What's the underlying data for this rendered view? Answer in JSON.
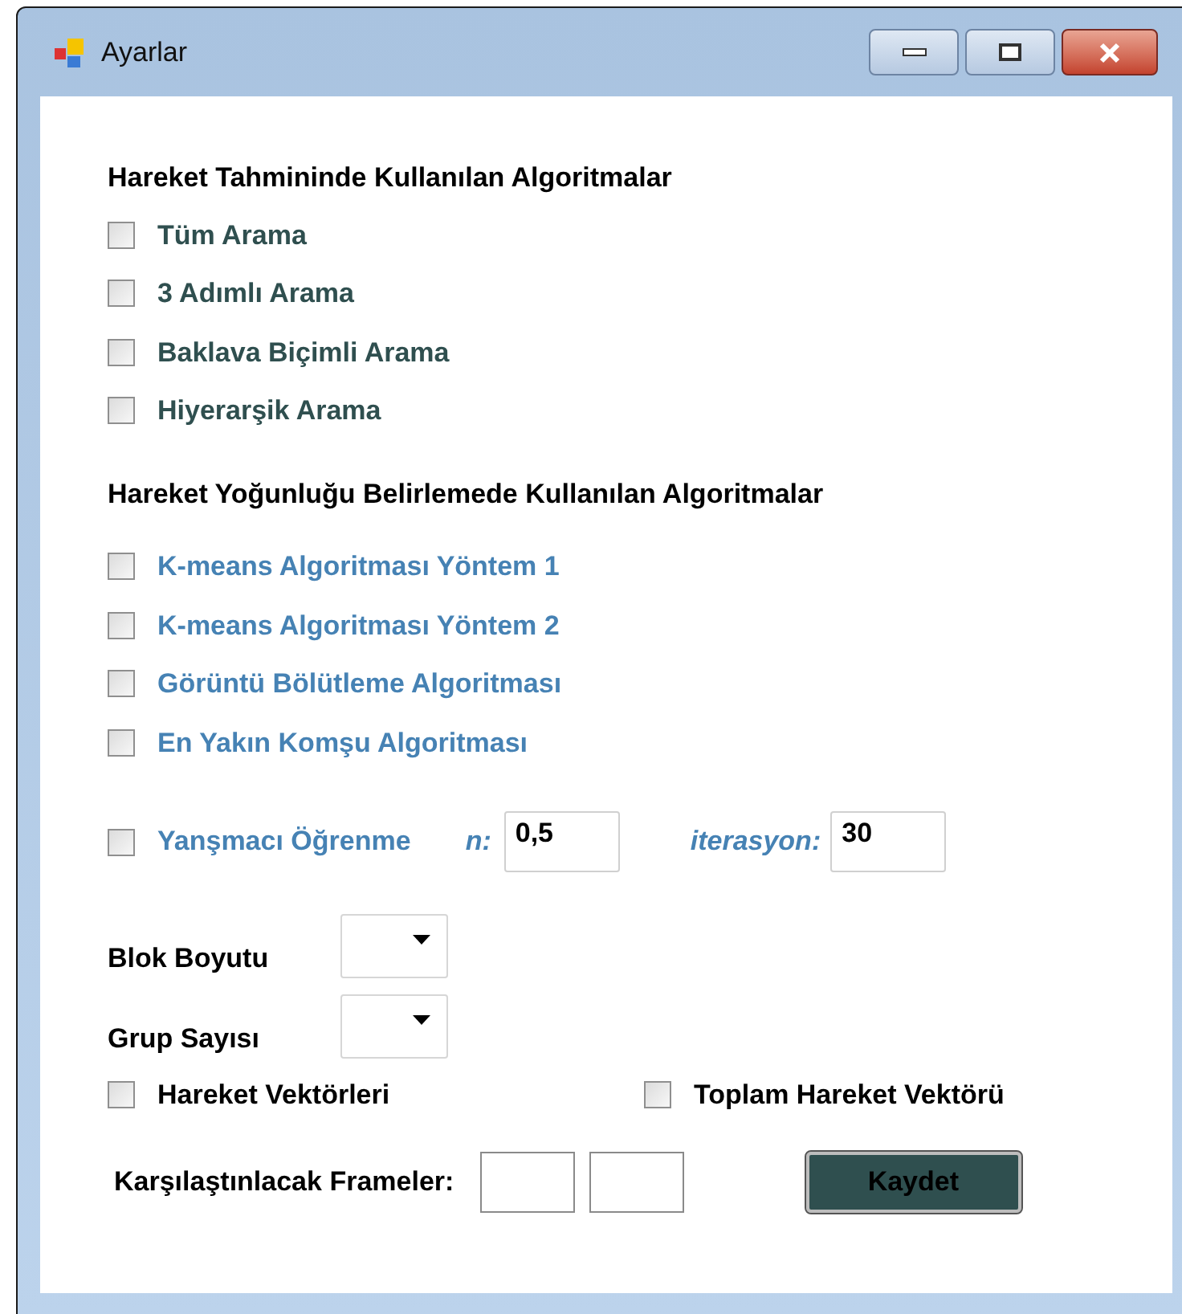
{
  "window": {
    "title": "Ayarlar"
  },
  "sections": [
    {
      "heading": "Hareket Tahmininde Kullanılan Algoritmalar",
      "items": [
        {
          "label": "Tüm Arama",
          "checked": false
        },
        {
          "label": "3 Adımlı Arama",
          "checked": false
        },
        {
          "label": "Baklava Biçimli Arama",
          "checked": false
        },
        {
          "label": "Hiyerarşik Arama",
          "checked": false
        }
      ]
    },
    {
      "heading": "Hareket Yoğunluğu Belirlemede Kullanılan Algoritmalar",
      "items": [
        {
          "label": "K-means Algoritması Yöntem 1",
          "checked": false
        },
        {
          "label": "K-means Algoritması Yöntem 2",
          "checked": false
        },
        {
          "label": "Görüntü Bölütleme Algoritması",
          "checked": false
        },
        {
          "label": "En Yakın Komşu Algoritması",
          "checked": false
        }
      ]
    }
  ],
  "competitive": {
    "label": "Yanşmacı Öğrenme",
    "checked": false,
    "n_label": "n:",
    "n_value": "0,5",
    "iter_label": "iterasyon:",
    "iter_value": "30"
  },
  "dropdowns": [
    {
      "label": "Blok Boyutu"
    },
    {
      "label": "Grup Sayısı"
    }
  ],
  "vectors": [
    {
      "label": "Hareket Vektörleri",
      "checked": false
    },
    {
      "label": "Toplam Hareket Vektörü",
      "checked": false
    }
  ],
  "frames": {
    "label": "Karşılaştınlacak Frameler:"
  },
  "buttons": [
    "Kaydet"
  ]
}
